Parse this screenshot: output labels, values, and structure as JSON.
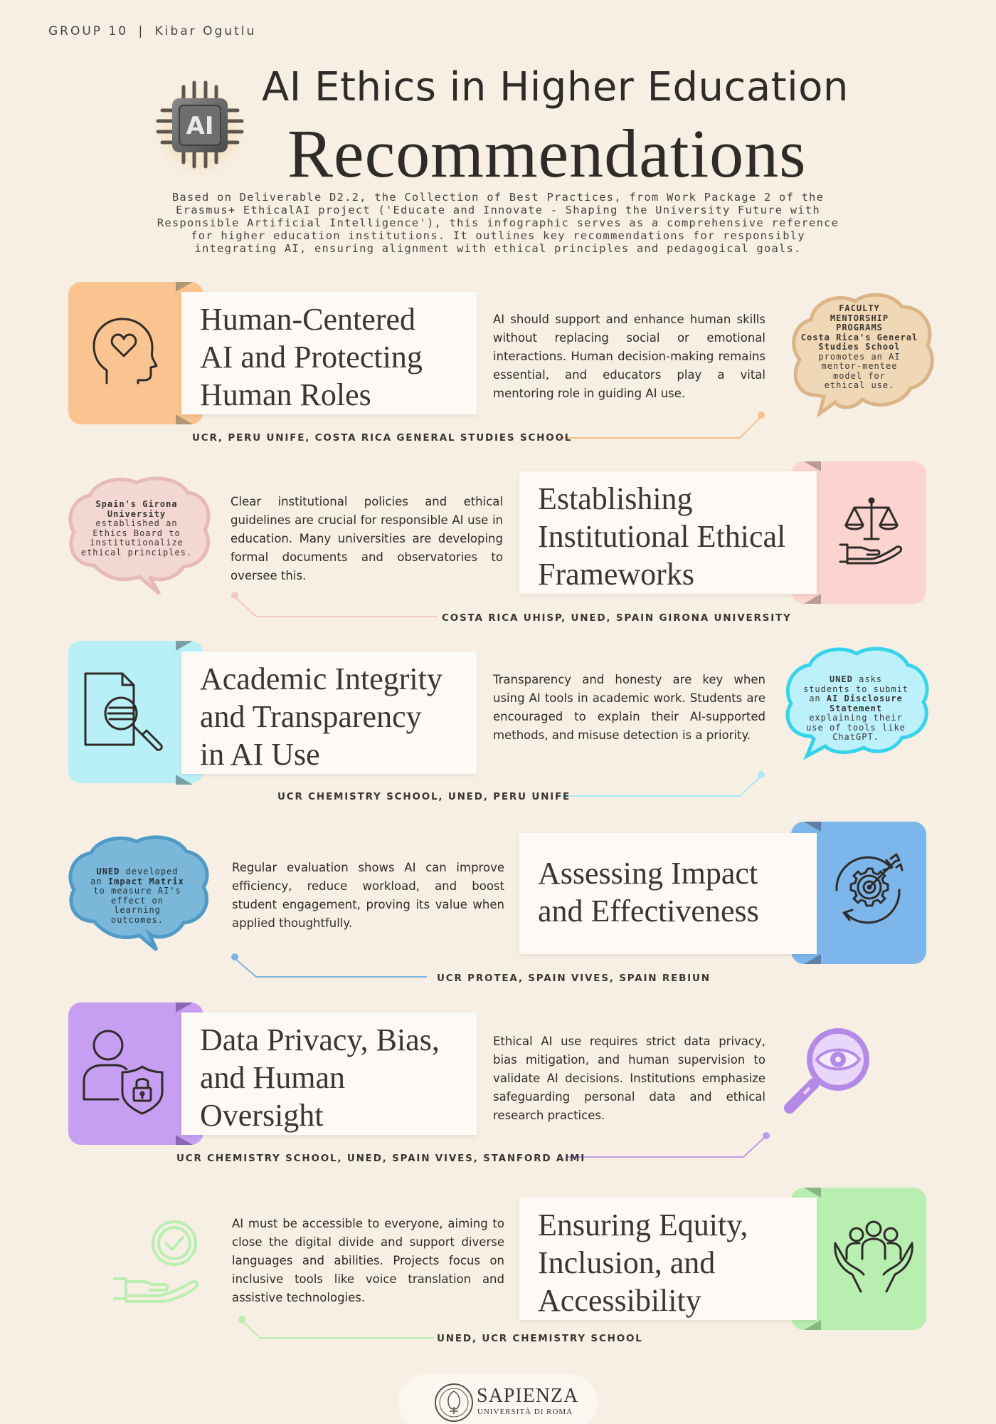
{
  "header": {
    "group": "GROUP 10",
    "separator": "|",
    "author": "Kibar Ogutlu",
    "title_line1": "AI Ethics in Higher Education",
    "title_line2": "Recommendations",
    "chip_label": "AI",
    "intro": "Based on Deliverable D2.2, the Collection of Best Practices, from Work Package 2 of the Erasmus+ EthicalAI project ('Educate and Innovate - Shaping the University Future with Responsible Artificial Intelligence'), this infographic serves as a comprehensive reference for higher education institutions. It outlines key recommendations for responsibly integrating AI, ensuring alignment with ethical principles and pedagogical goals."
  },
  "sections": [
    {
      "title": "Human-Centered AI and Protecting Human Roles",
      "title_lines": [
        "Human-Centered",
        "AI and Protecting",
        "Human Roles"
      ],
      "body": "AI should support and enhance human skills without replacing social or emotional interactions. Human decision-making remains essential, and educators play a vital mentoring role in guiding AI use.",
      "sources": "UCR, PERU UNIFE, COSTA RICA GENERAL STUDIES SCHOOL",
      "bubble": [
        "FACULTY",
        "MENTORSHIP",
        "PROGRAMS",
        "Costa Rica's General",
        "Studies School",
        "promotes an AI",
        "mentor-mentee",
        "model for",
        "ethical use."
      ],
      "icon": "head-heart-icon",
      "color": "#f9c48f",
      "bubble_color": "#e7c8a0"
    },
    {
      "title": "Establishing Institutional Ethical Frameworks",
      "title_lines": [
        "Establishing",
        "Institutional Ethical",
        "Frameworks"
      ],
      "body": "Clear institutional policies and ethical guidelines are crucial for responsible AI use in education. Many universities are developing formal documents and observatories to oversee this.",
      "sources": "COSTA RICA UHISP, UNED, SPAIN GIRONA UNIVERSITY",
      "bubble": [
        "Spain's Girona",
        "University",
        "established an",
        "Ethics Board to",
        "institutionalize",
        "ethical principles."
      ],
      "icon": "scales-hand-icon",
      "color": "#fbd3cf",
      "bubble_color": "#ecc9c3"
    },
    {
      "title": "Academic Integrity and Transparency in AI Use",
      "title_lines": [
        "Academic Integrity",
        "and Transparency",
        "in AI Use"
      ],
      "body": "Transparency and honesty are key when using AI tools in academic work. Students are encouraged to explain their AI-supported methods, and misuse detection is a priority.",
      "sources": "UCR CHEMISTRY SCHOOL, UNED, PERU UNIFE",
      "bubble": [
        "UNED asks",
        "students to submit",
        "an AI Disclosure",
        "Statement",
        "explaining their",
        "use of tools like",
        "ChatGPT."
      ],
      "icon": "document-magnifier-icon",
      "color": "#b9f0f8",
      "bubble_color": "#b6eefb"
    },
    {
      "title": "Assessing Impact and Effectiveness",
      "title_lines": [
        "Assessing Impact",
        "and Effectiveness"
      ],
      "body": "Regular evaluation shows AI can improve efficiency, reduce workload, and boost student engagement, proving its value when applied thoughtfully.",
      "sources": "UCR PROTEA, SPAIN VIVES, SPAIN REBIUN",
      "bubble": [
        "UNED developed",
        "an Impact Matrix",
        "to measure AI's",
        "effect on",
        "learning",
        "outcomes."
      ],
      "icon": "target-gear-icon",
      "color": "#7cb6ea",
      "bubble_color": "#7fb6d9"
    },
    {
      "title": "Data Privacy, Bias, and Human Oversight",
      "title_lines": [
        "Data Privacy, Bias,",
        "and Human",
        "Oversight"
      ],
      "body": "Ethical AI use requires strict data privacy, bias mitigation, and human supervision to validate AI decisions. Institutions emphasize safeguarding personal data and ethical research practices.",
      "sources": "UCR CHEMISTRY SCHOOL, UNED, SPAIN VIVES, STANFORD AIMI",
      "icon": "person-shield-lock-icon",
      "side_icon": "eye-magnifier-icon",
      "color": "#c79ff2"
    },
    {
      "title": "Ensuring Equity, Inclusion, and Accessibility",
      "title_lines": [
        "Ensuring Equity,",
        "Inclusion, and",
        "Accessibility"
      ],
      "body": "AI must be accessible to everyone, aiming to close the digital divide and support diverse languages and abilities. Projects focus on inclusive tools like voice translation and assistive technologies.",
      "sources": "UNED, UCR CHEMISTRY SCHOOL",
      "icon": "hands-people-icon",
      "side_icon": "hand-check-icon",
      "color": "#b8eeb0"
    }
  ],
  "footer": {
    "logo_name": "SAPIENZA",
    "logo_sub": "UNIVERSITÀ DI ROMA"
  }
}
